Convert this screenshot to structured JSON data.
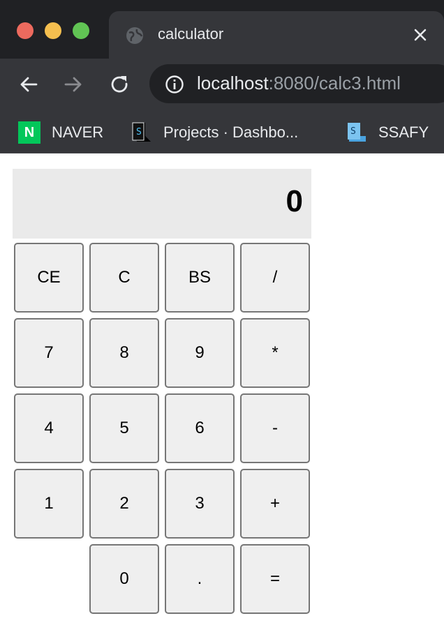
{
  "browser": {
    "tab_title": "calculator",
    "url_host": "localhost",
    "url_rest": ":8080/calc3.html",
    "bookmarks": [
      {
        "label": "NAVER",
        "icon": "naver-logo-icon",
        "color": "#03c75a",
        "logo_text": "N"
      },
      {
        "label": "Projects · Dashbo...",
        "icon": "ssafy-dark-icon"
      },
      {
        "label": "SSAFY",
        "icon": "ssafy-blue-icon"
      }
    ]
  },
  "calculator": {
    "display": "0",
    "keys": {
      "ce": "CE",
      "c": "C",
      "bs": "BS",
      "div": "/",
      "k7": "7",
      "k8": "8",
      "k9": "9",
      "mul": "*",
      "k4": "4",
      "k5": "5",
      "k6": "6",
      "sub": "-",
      "k1": "1",
      "k2": "2",
      "k3": "3",
      "add": "+",
      "k0": "0",
      "dot": ".",
      "eq": "="
    }
  },
  "colors": {
    "chrome_dark": "#202124",
    "chrome_tab": "#35363a",
    "display_bg": "#eaeaea",
    "key_bg": "#efefef"
  }
}
